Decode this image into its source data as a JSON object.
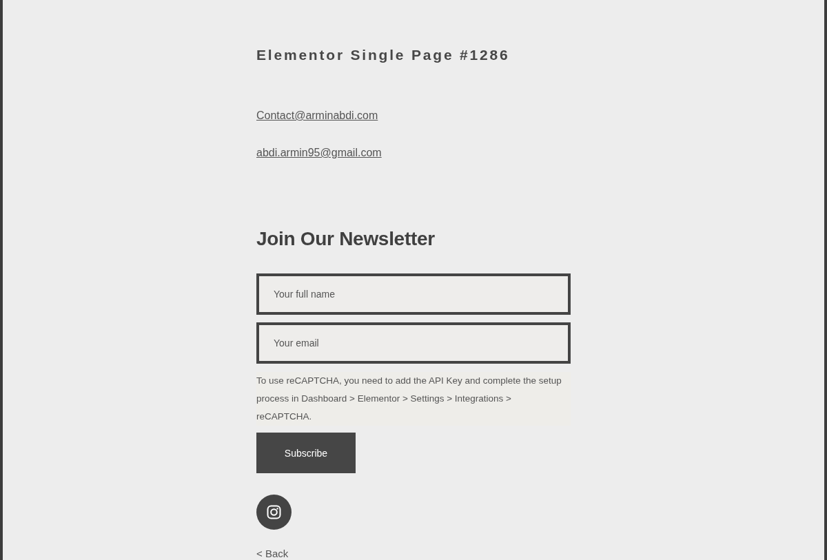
{
  "page": {
    "title": "Elementor Single Page #1286"
  },
  "contacts": [
    "Contact@arminabdi.com",
    "abdi.armin95@gmail.com"
  ],
  "newsletter": {
    "heading": "Join Our Newsletter",
    "fields": [
      {
        "placeholder": "Your full name"
      },
      {
        "placeholder": "Your email"
      }
    ],
    "notice": "To use reCAPTCHA, you need to add the API Key and complete the setup process in Dashboard > Elementor > Settings > Integrations > reCAPTCHA.",
    "button": "Subscribe"
  },
  "back_link": "< Back"
}
